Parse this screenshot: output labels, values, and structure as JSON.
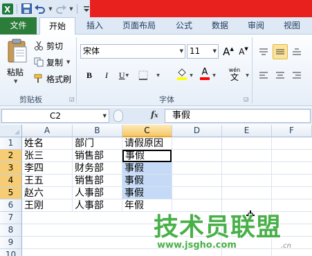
{
  "quick_access": {
    "excel_icon": "excel-icon",
    "save_icon": "save-icon",
    "undo_icon": "undo-icon",
    "redo_icon": "redo-icon",
    "customize_icon": "customize-qat-icon"
  },
  "colors": {
    "title_bar_fill": "#e8201e",
    "file_tab": "#2c7d3a",
    "selection_highlight": "#c5daf6",
    "watermark_green": "#49b049"
  },
  "tabs": [
    {
      "label": "文件"
    },
    {
      "label": "开始"
    },
    {
      "label": "插入"
    },
    {
      "label": "页面布局"
    },
    {
      "label": "公式"
    },
    {
      "label": "数据"
    },
    {
      "label": "审阅"
    },
    {
      "label": "视图"
    }
  ],
  "clipboard": {
    "paste_label": "粘贴",
    "cut_label": "剪切",
    "copy_label": "复制",
    "format_painter_label": "格式刷",
    "group_label": "剪贴板"
  },
  "font": {
    "font_name": "宋体",
    "font_size": "11",
    "grow_label": "A",
    "shrink_label": "A",
    "bold": "B",
    "italic": "I",
    "underline": "U",
    "font_color_label": "A",
    "phonetic_label": "wén",
    "phonetic_char": "文",
    "group_label": "字体"
  },
  "formula_bar": {
    "name_box": "C2",
    "fx_label": "fx",
    "content": "事假"
  },
  "sheet": {
    "columns": [
      "A",
      "B",
      "C",
      "D",
      "E",
      "F"
    ],
    "rows": [
      "1",
      "2",
      "3",
      "4",
      "5",
      "6",
      "7",
      "8",
      "9",
      "10"
    ],
    "cells": [
      [
        "姓名",
        "部门",
        "请假原因"
      ],
      [
        "张三",
        "销售部",
        "事假"
      ],
      [
        "李四",
        "财务部",
        "事假"
      ],
      [
        "王五",
        "销售部",
        "事假"
      ],
      [
        "赵六",
        "人事部",
        "事假"
      ],
      [
        "王刚",
        "人事部",
        "年假"
      ]
    ],
    "active_cell": "C2",
    "selected_range": "C2:C5"
  },
  "watermark": {
    "title": "技术员联盟",
    "url": "www.jsgho.com",
    "suffix": ".cn"
  }
}
